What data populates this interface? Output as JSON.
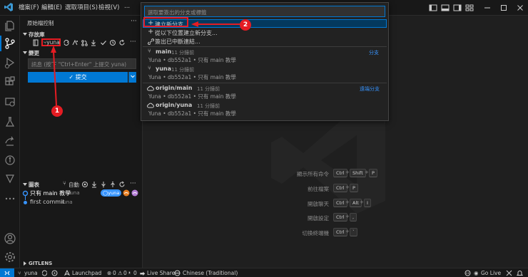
{
  "titlebar": {
    "menus": [
      "檔案(F)",
      "編輯(E)",
      "選取項目(S)",
      "檢視(V)",
      "..."
    ]
  },
  "sidebar": {
    "view_title": "原始檔控制",
    "repos_label": "存放庫",
    "branch_name": "yuna",
    "changes_label": "變更",
    "message_placeholder": "訊息 (按下 \"Ctrl+Enter\" 上提交 yuna)",
    "commit_label": "✓ 提交",
    "graph_label": "圖表",
    "graph_auto": "自動",
    "graph_badge": "yuna",
    "graph_items": [
      {
        "message": "只有 main 教學",
        "author": "Yuna"
      },
      {
        "message": "first commit",
        "author": "Yuna"
      }
    ],
    "gitlens_label": "GITLENS"
  },
  "quickpick": {
    "placeholder": "選取要簽出的分支或標籤",
    "actions": [
      "建立新分支...",
      "從以下位置建立新分支...",
      "簽出已中斷連結..."
    ],
    "branch_group": "分支",
    "remote_group": "遠端分支",
    "branches": [
      {
        "name": "main",
        "time": "11 分鐘前",
        "detail": "Yuna • db552a1 • 只有 main 教學"
      },
      {
        "name": "yuna",
        "time": "11 分鐘前",
        "detail": "Yuna • db552a1 • 只有 main 教學"
      }
    ],
    "remotes": [
      {
        "name": "origin/main",
        "time": "11 分鐘前",
        "detail": "Yuna • db552a1 • 只有 main 教學"
      },
      {
        "name": "origin/yuna",
        "time": "11 分鐘前",
        "detail": "Yuna • db552a1 • 只有 main 教學"
      }
    ]
  },
  "shortcuts": [
    {
      "label": "顯示所有命令",
      "keys": [
        "Ctrl",
        "Shift",
        "P"
      ]
    },
    {
      "label": "前往檔案",
      "keys": [
        "Ctrl",
        "P"
      ]
    },
    {
      "label": "開啟聊天",
      "keys": [
        "Ctrl",
        "Alt",
        "I"
      ]
    },
    {
      "label": "開啟設定",
      "keys": [
        "Ctrl",
        ","
      ]
    },
    {
      "label": "切換終端機",
      "keys": [
        "Ctrl",
        "`"
      ]
    }
  ],
  "statusbar": {
    "branch": "yuna",
    "launchpad": "Launchpad",
    "problems": "0",
    "warnings": "0",
    "ports": "0",
    "liveshare": "Live Share",
    "language": "Chinese (Traditional)",
    "golive": "Go Live"
  },
  "annotations": {
    "one": "1",
    "two": "2"
  },
  "colors": {
    "accent": "#0078d4",
    "annotation": "#e51c23",
    "bg": "#1f1f1f",
    "sidebar": "#181818"
  }
}
